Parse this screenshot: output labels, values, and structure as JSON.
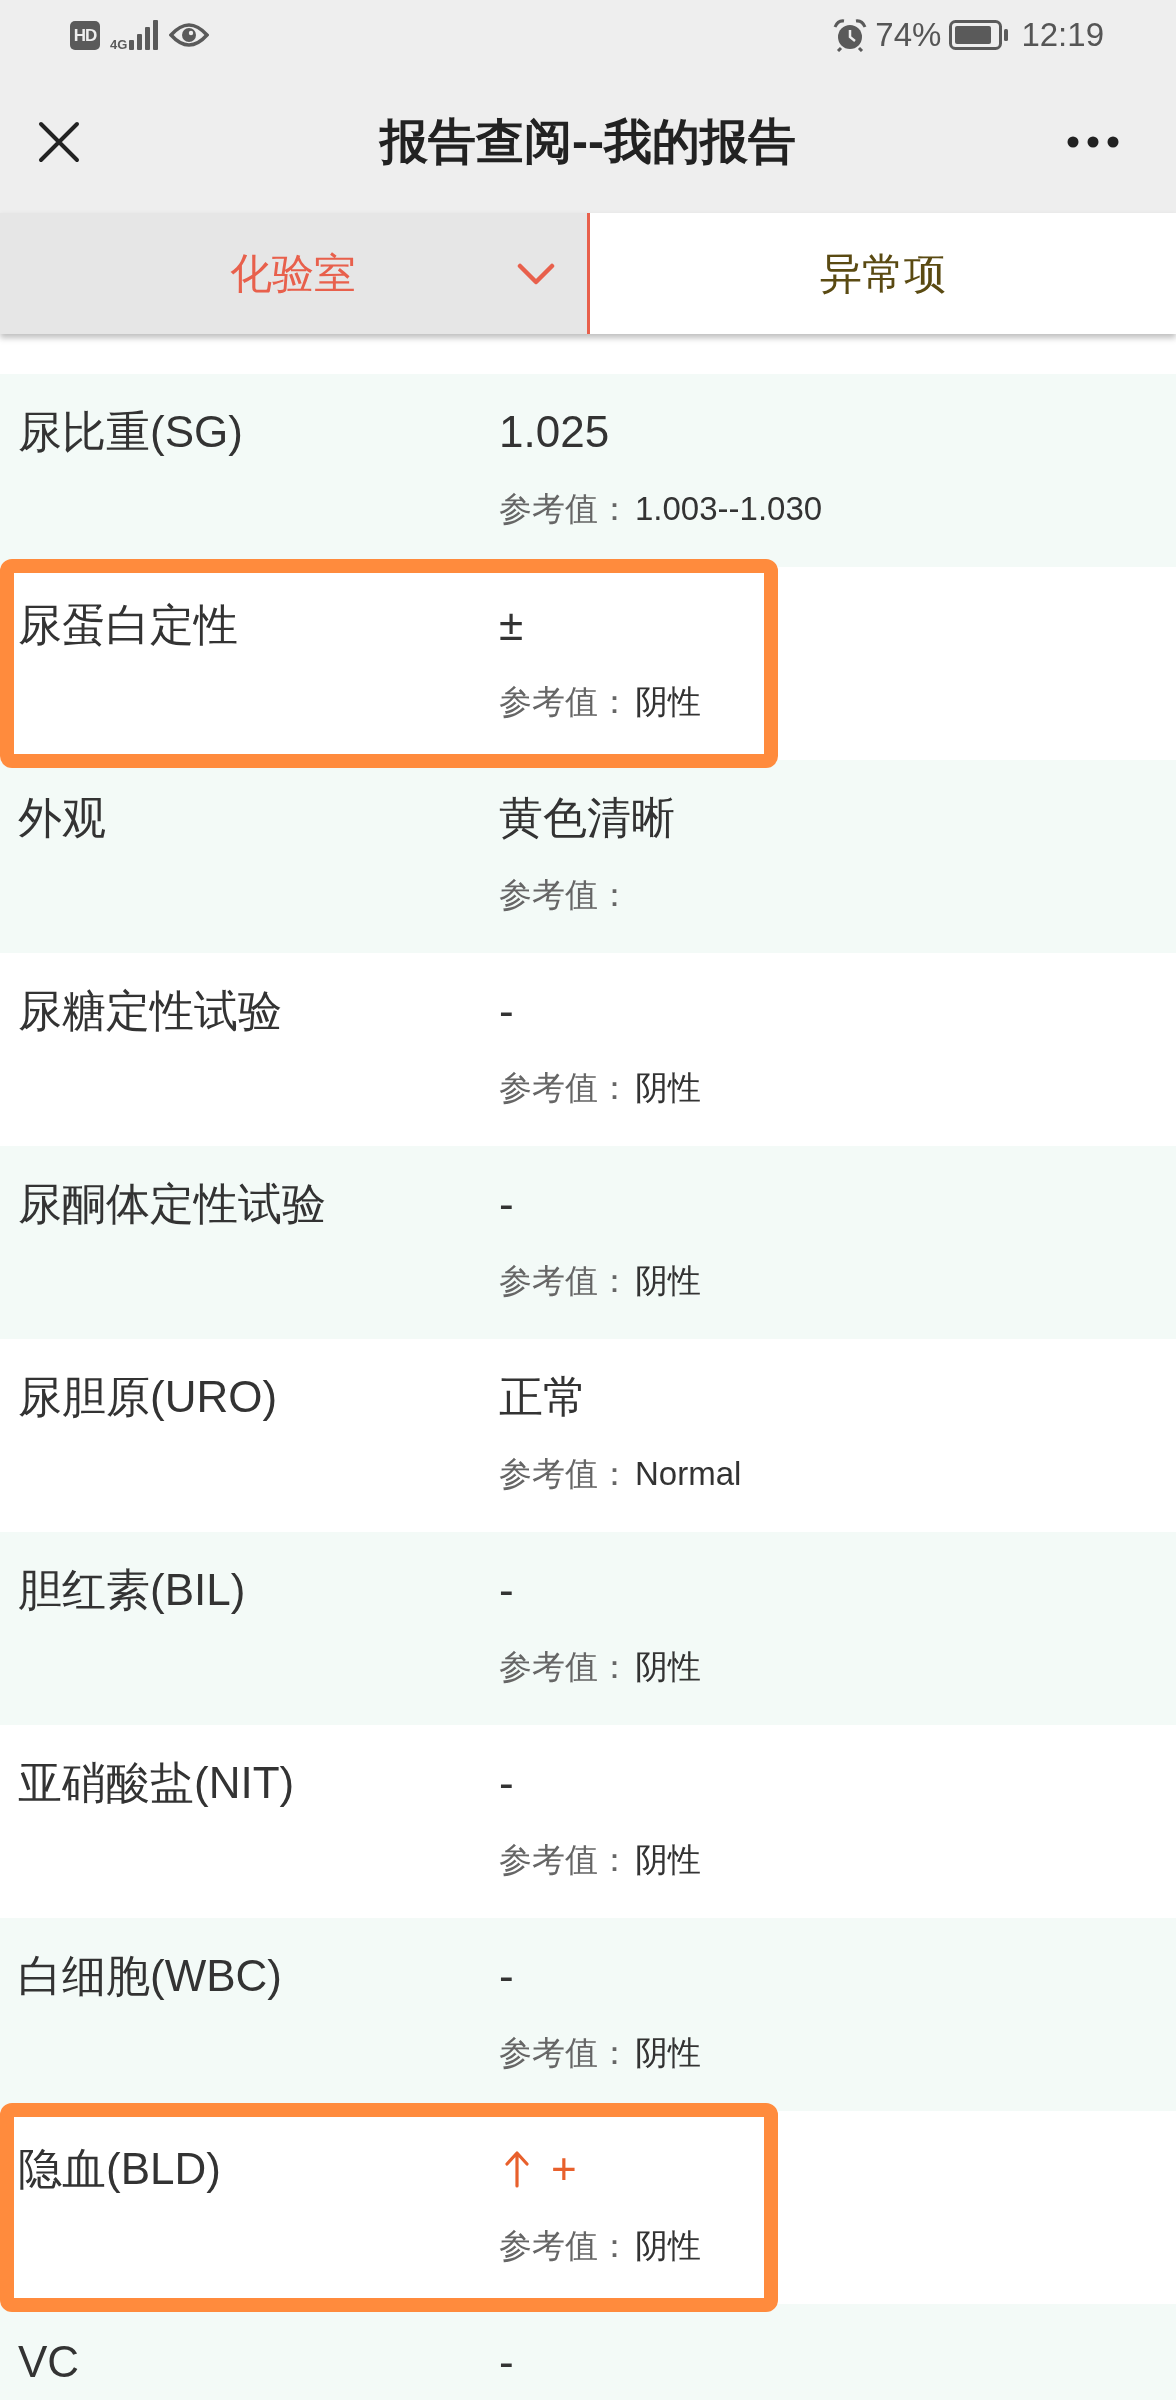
{
  "status_bar": {
    "badge": "HD",
    "network": "4G",
    "battery": "74%",
    "time": "12:19"
  },
  "nav": {
    "title": "报告查阅--我的报告"
  },
  "tabs": [
    {
      "label": "化验室",
      "selected": true,
      "dropdown": true
    },
    {
      "label": "异常项",
      "selected": false,
      "dropdown": false
    }
  ],
  "results": [
    {
      "name": "尿比重(SG)",
      "value": "1.025",
      "ref_label": "参考值：",
      "ref": "1.003--1.030",
      "elevated": false,
      "highlighted": false
    },
    {
      "name": "尿蛋白定性",
      "value": "±",
      "ref_label": "参考值：",
      "ref": "阴性",
      "elevated": false,
      "highlighted": true
    },
    {
      "name": "外观",
      "value": "黄色清晰",
      "ref_label": "参考值：",
      "elevated": false,
      "highlighted": false
    },
    {
      "name": "尿糖定性试验",
      "value": "-",
      "ref_label": "参考值：",
      "ref": "阴性",
      "elevated": false,
      "highlighted": false
    },
    {
      "name": "尿酮体定性试验",
      "value": "-",
      "ref_label": "参考值：",
      "ref": "阴性",
      "elevated": false,
      "highlighted": false
    },
    {
      "name": "尿胆原(URO)",
      "value": "正常",
      "ref_label": "参考值：",
      "ref": "Normal",
      "elevated": false,
      "highlighted": false
    },
    {
      "name": "胆红素(BIL)",
      "value": "-",
      "ref_label": "参考值：",
      "ref": "阴性",
      "elevated": false,
      "highlighted": false
    },
    {
      "name": "亚硝酸盐(NIT)",
      "value": "-",
      "ref_label": "参考值：",
      "ref": "阴性",
      "elevated": false,
      "highlighted": false
    },
    {
      "name": "白细胞(WBC)",
      "value": "-",
      "ref_label": "参考值：",
      "ref": "阴性",
      "elevated": false,
      "highlighted": false
    },
    {
      "name": "隐血(BLD)",
      "value": "+",
      "ref_label": "参考值：",
      "ref": "阴性",
      "elevated": true,
      "highlighted": true
    },
    {
      "name": "VC",
      "value": "-",
      "elevated": false,
      "highlighted": false
    }
  ]
}
